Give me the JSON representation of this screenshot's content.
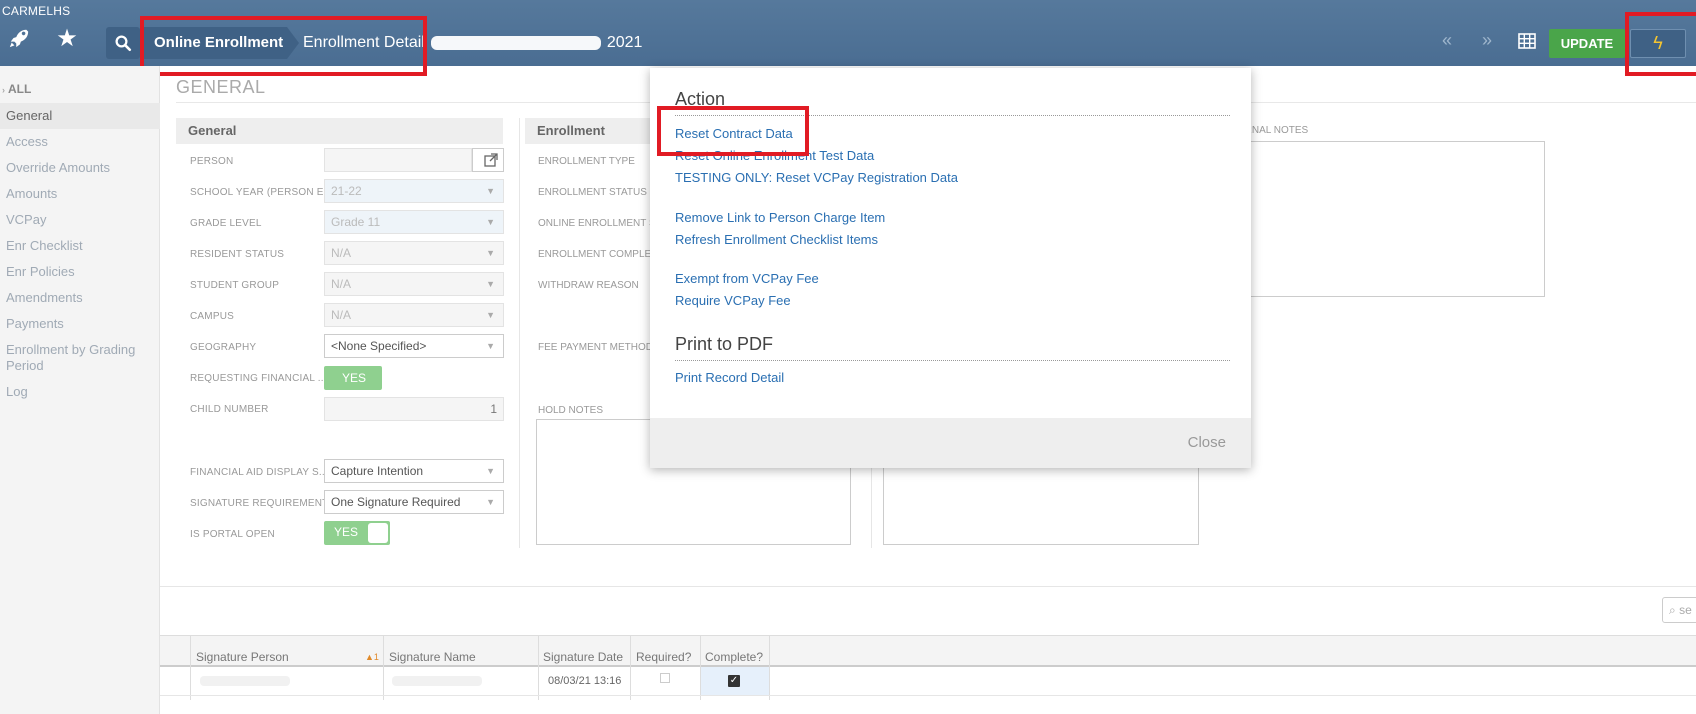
{
  "app": {
    "name": "CARMELHS"
  },
  "breadcrumb": {
    "root": "Online Enrollment",
    "current_prefix": "Enrollment Detail",
    "current_suffix": "2021"
  },
  "toolbar": {
    "update_label": "UPDATE"
  },
  "icons": {
    "rocket": "rocket-icon",
    "star": "star-icon",
    "search": "search-icon",
    "prev": "double-chevron-left-icon",
    "next": "double-chevron-right-icon",
    "grid": "grid-icon",
    "action": "lightning-bolt-icon"
  },
  "colors": {
    "topbar": "#4a6d92",
    "update": "#4aa54a",
    "highlight": "#e11b24",
    "link": "#2a6fb2"
  },
  "sidebar": {
    "all_label": "ALL",
    "items": [
      "General",
      "Access",
      "Override Amounts",
      "Amounts",
      "VCPay",
      "Enr Checklist",
      "Enr Policies",
      "Amendments",
      "Payments",
      "Enrollment by Grading Period",
      "Log"
    ]
  },
  "section": {
    "title": "GENERAL"
  },
  "general_panel": {
    "title": "General",
    "fields": [
      {
        "label": "PERSON",
        "value": ""
      },
      {
        "label": "SCHOOL YEAR (PERSON E...",
        "value": "21-22"
      },
      {
        "label": "GRADE LEVEL",
        "value": "Grade 11"
      },
      {
        "label": "RESIDENT STATUS",
        "value": "N/A"
      },
      {
        "label": "STUDENT GROUP",
        "value": "N/A"
      },
      {
        "label": "CAMPUS",
        "value": "N/A"
      },
      {
        "label": "GEOGRAPHY",
        "value": "<None Specified>"
      },
      {
        "label": "REQUESTING FINANCIAL ...",
        "value": "YES"
      },
      {
        "label": "CHILD NUMBER",
        "value": "1"
      },
      {
        "label": "FINANCIAL AID DISPLAY S...",
        "value": "Capture Intention"
      },
      {
        "label": "SIGNATURE REQUIREMENT",
        "value": "One Signature Required"
      },
      {
        "label": "IS PORTAL OPEN",
        "value": "YES"
      }
    ]
  },
  "enrollment_panel": {
    "title": "Enrollment",
    "labels": [
      "ENROLLMENT TYPE",
      "ENROLLMENT STATUS",
      "ONLINE ENROLLMENT S",
      "ENROLLMENT COMPLET",
      "WITHDRAW REASON",
      "FEE PAYMENT METHOD",
      "HOLD NOTES"
    ]
  },
  "notes": {
    "label": "ERNAL NOTES"
  },
  "action_popover": {
    "heading_action": "Action",
    "links_group1": [
      "Reset Contract Data",
      "Reset Online Enrollment Test Data",
      "TESTING ONLY: Reset VCPay Registration Data"
    ],
    "links_group2": [
      "Remove Link to Person Charge Item",
      "Refresh Enrollment Checklist Items"
    ],
    "links_group3": [
      "Exempt from VCPay Fee",
      "Require VCPay Fee"
    ],
    "heading_print": "Print to PDF",
    "print_links": [
      "Print Record Detail"
    ],
    "close_label": "Close"
  },
  "signature_grid": {
    "search_placeholder": "se",
    "columns": [
      "Signature Person",
      "Signature Name",
      "Signature Date",
      "Required?",
      "Complete?"
    ],
    "sort_indicator": "▲1",
    "rows": [
      {
        "person": "",
        "name": "",
        "date": "08/03/21 13:16",
        "required": false,
        "complete": true
      }
    ]
  }
}
